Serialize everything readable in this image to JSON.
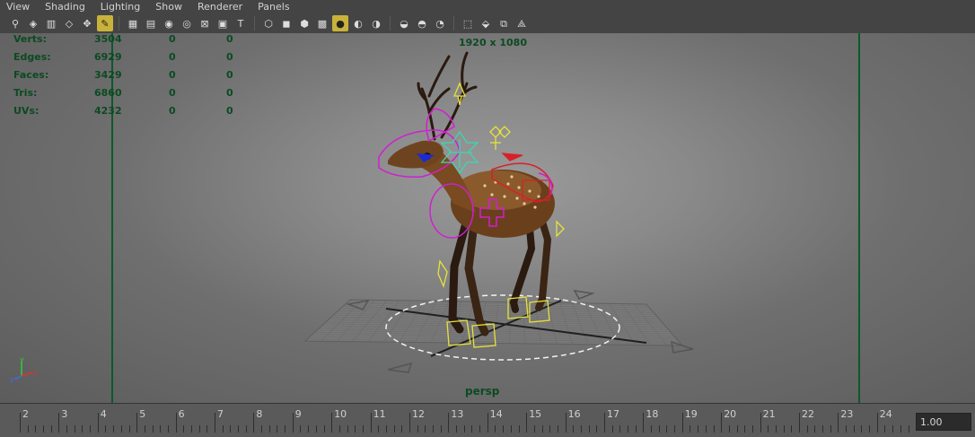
{
  "menu": [
    "View",
    "Shading",
    "Lighting",
    "Show",
    "Renderer",
    "Panels"
  ],
  "toolbar": {
    "groups": [
      [
        "select-camera-icon",
        "camera-attributes-icon",
        "bookmark-icon",
        "image-plane-icon",
        "2d-pan-zoom-icon",
        "grease-pencil-icon"
      ],
      [
        "grid-icon",
        "film-gate-icon",
        "resolution-gate-icon",
        "gate-mask-icon",
        "field-chart-icon",
        "safe-action-icon",
        "safe-title-icon"
      ],
      [
        "wireframe-icon",
        "smooth-shade-icon",
        "wireframe-on-shaded-icon",
        "textured-icon",
        "use-all-lights-icon",
        "shadows-icon",
        "screen-space-ao-icon"
      ],
      [
        "motion-blur-icon",
        "multisample-aa-icon",
        "depth-of-field-icon"
      ],
      [
        "isolate-select-icon",
        "xray-icon",
        "xray-active-components-icon",
        "xray-joints-icon"
      ]
    ]
  },
  "hud": {
    "rows": [
      {
        "label": "Verts:",
        "v1": "3504",
        "v2": "0",
        "v3": "0"
      },
      {
        "label": "Edges:",
        "v1": "6929",
        "v2": "0",
        "v3": "0"
      },
      {
        "label": "Faces:",
        "v1": "3429",
        "v2": "0",
        "v3": "0"
      },
      {
        "label": "Tris:",
        "v1": "6860",
        "v2": "0",
        "v3": "0"
      },
      {
        "label": "UVs:",
        "v1": "4232",
        "v2": "0",
        "v3": "0"
      }
    ],
    "resolution": "1920 x 1080",
    "camera": "persp"
  },
  "axis": {
    "x": "x",
    "y": "y",
    "z": "z"
  },
  "timeslider": {
    "ticks": [
      "2",
      "3",
      "4",
      "5",
      "6",
      "7",
      "8",
      "9",
      "10",
      "11",
      "12",
      "13",
      "14",
      "15",
      "16",
      "17",
      "18",
      "19",
      "20",
      "21",
      "22",
      "23",
      "24"
    ],
    "current_value": "1.00"
  },
  "colors": {
    "gate": "#0b5a2a",
    "hud_text": "#0c4a22",
    "control_magenta": "#d21ed2",
    "control_yellow": "#e8e23a",
    "control_cyan": "#3fd6b0",
    "control_red": "#d8202a"
  }
}
